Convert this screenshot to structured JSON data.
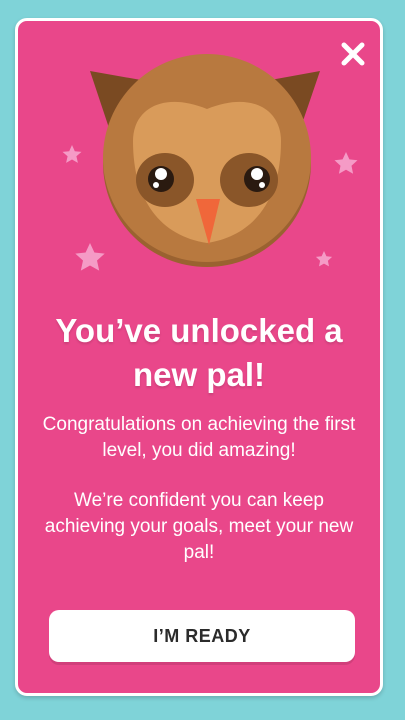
{
  "colors": {
    "background": "#7fd3d8",
    "card": "#e9478a",
    "button": "#ffffff",
    "button_text": "#2b2b2b",
    "owl_face": "#d99b5a",
    "owl_head": "#b8793f",
    "owl_ears": "#7a4a22",
    "beak": "#f0673a",
    "stars": "#f59bc6"
  },
  "icons": {
    "close": "close-icon",
    "mascot": "owl-illustration",
    "decor": "star-icon"
  },
  "title": "You’ve unlocked a new pal!",
  "message_1": "Congratulations on achieving the first level, you did amazing!",
  "message_2": "We’re confident you can keep achieving your goals, meet your new pal!",
  "cta_label": "I’M READY"
}
